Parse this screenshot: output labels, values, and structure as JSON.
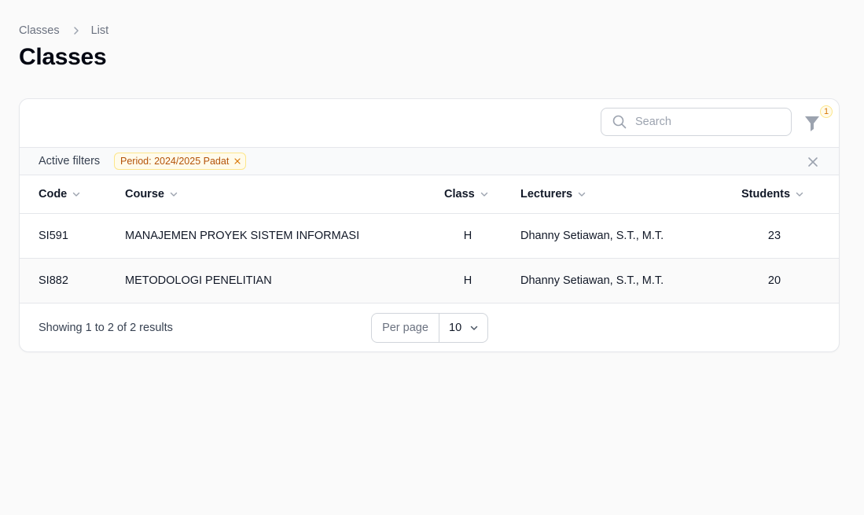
{
  "breadcrumb": {
    "parent": "Classes",
    "current": "List"
  },
  "page": {
    "title": "Classes"
  },
  "toolbar": {
    "search_placeholder": "Search",
    "filter_count": "1"
  },
  "active_filters": {
    "label": "Active filters",
    "chip": "Period: 2024/2025 Padat"
  },
  "table": {
    "columns": [
      "Code",
      "Course",
      "Class",
      "Lecturers",
      "Students"
    ],
    "rows": [
      [
        "SI591",
        "MANAJEMEN PROYEK SISTEM INFORMASI",
        "H",
        "Dhanny Setiawan, S.T., M.T.",
        "23"
      ],
      [
        "SI882",
        "METODOLOGI PENELITIAN",
        "H",
        "Dhanny Setiawan, S.T., M.T.",
        "20"
      ]
    ]
  },
  "footer": {
    "showing": "Showing 1 to 2 of 2 results",
    "per_page_label": "Per page",
    "per_page_value": "10"
  },
  "colors": {
    "accent": "#d97706",
    "chip_bg": "#fffbeb",
    "chip_border": "#fde68a"
  }
}
